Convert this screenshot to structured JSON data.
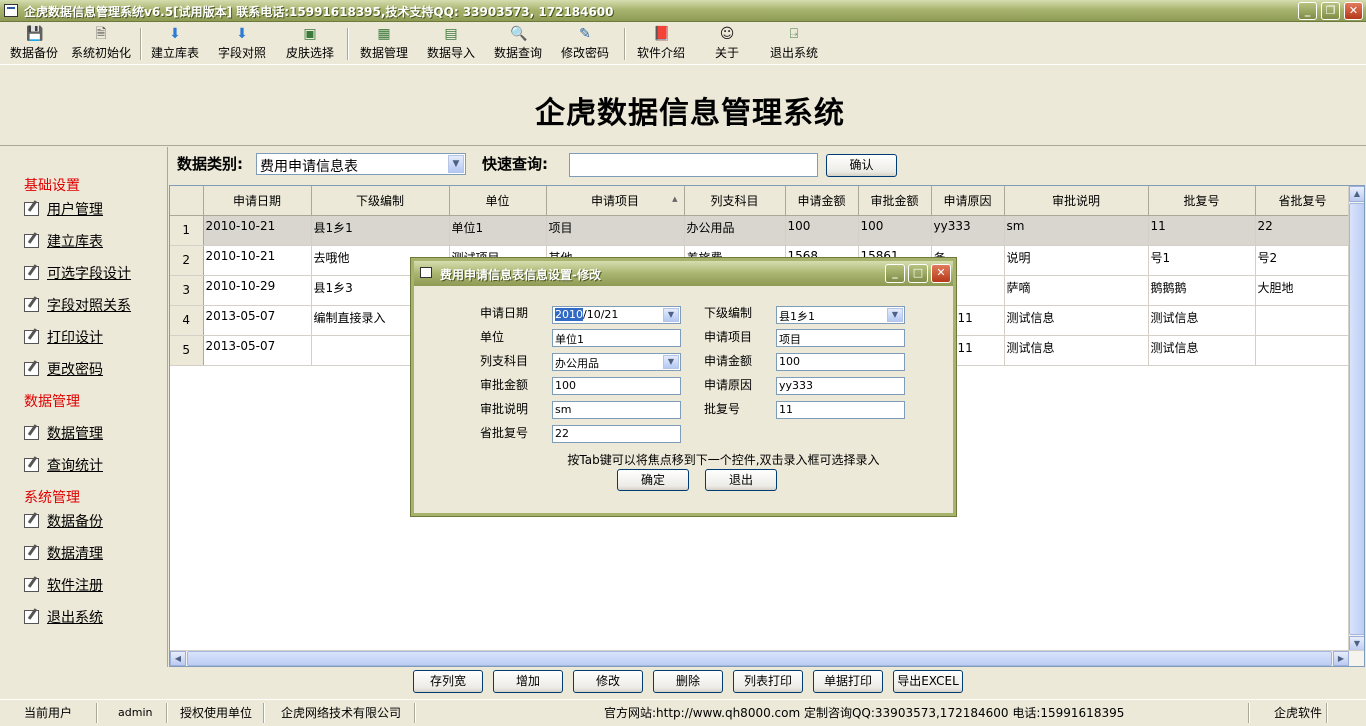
{
  "window": {
    "title": "企虎数据信息管理系统v6.5[试用版本]   联系电话:15991618395,技术支持QQ: 33903573, 172184600"
  },
  "toolbar": [
    {
      "label": "数据备份",
      "icon": "floppy-icon"
    },
    {
      "label": "系统初始化",
      "icon": "document-icon"
    },
    {
      "label": "建立库表",
      "icon": "arrow-down-icon"
    },
    {
      "label": "字段对照",
      "icon": "arrow-down-icon"
    },
    {
      "label": "皮肤选择",
      "icon": "image-icon"
    },
    {
      "label": "数据管理",
      "icon": "grid-icon"
    },
    {
      "label": "数据导入",
      "icon": "import-icon"
    },
    {
      "label": "数据查询",
      "icon": "magnifier-icon"
    },
    {
      "label": "修改密码",
      "icon": "pen-icon"
    },
    {
      "label": "软件介绍",
      "icon": "book-icon"
    },
    {
      "label": "关于",
      "icon": "person-icon"
    },
    {
      "label": "退出系统",
      "icon": "exit-door-icon"
    }
  ],
  "banner": {
    "heading": "企虎数据信息管理系统"
  },
  "sidebar": {
    "sections": [
      {
        "title": "基础设置",
        "items": [
          "用户管理",
          "建立库表",
          "可选字段设计",
          "字段对照关系",
          "打印设计",
          "更改密码"
        ]
      },
      {
        "title": "数据管理",
        "items": [
          "数据管理",
          "查询统计"
        ]
      },
      {
        "title": "系统管理",
        "items": [
          "数据备份",
          "数据清理",
          "软件注册",
          "退出系统"
        ]
      }
    ]
  },
  "filter": {
    "category_label": "数据类别:",
    "category_value": "费用申请信息表",
    "search_label": "快速查询:",
    "search_value": "",
    "confirm_label": "确认"
  },
  "grid": {
    "columns": [
      "申请日期",
      "下级编制",
      "单位",
      "申请项目",
      "列支科目",
      "申请金额",
      "审批金额",
      "申请原因",
      "审批说明",
      "批复号",
      "省批复号"
    ],
    "rows": [
      {
        "num": "1",
        "cells": [
          "2010-10-21",
          "县1乡1",
          "单位1",
          "项目",
          "办公用品",
          "100",
          "100",
          "yy333",
          "sm",
          "11",
          "22"
        ]
      },
      {
        "num": "2",
        "cells": [
          "2010-10-21",
          "去哦他",
          "测试项目",
          "其他",
          "差旅费",
          "1568",
          "15861",
          "务",
          "说明",
          "号1",
          "号2"
        ]
      },
      {
        "num": "3",
        "cells": [
          "2010-10-29",
          "县1乡3",
          "",
          "",
          "",
          "",
          "",
          "",
          "萨嘀",
          "鹅鹅鹅",
          "大胆地"
        ]
      },
      {
        "num": "4",
        "cells": [
          "2013-05-07",
          "编制直接录入",
          "",
          "",
          "",
          "",
          "",
          "信息11",
          "测试信息",
          "测试信息",
          ""
        ]
      },
      {
        "num": "5",
        "cells": [
          "2013-05-07",
          "",
          "",
          "",
          "",
          "",
          "",
          "信息11",
          "测试信息",
          "测试信息",
          ""
        ]
      }
    ]
  },
  "actions": [
    "存列宽",
    "增加",
    "修改",
    "删除",
    "列表打印",
    "单据打印",
    "导出EXCEL"
  ],
  "statusbar": {
    "user_label": "当前用户",
    "user_value": "admin",
    "org_label": "授权使用单位",
    "org_value": "企虎网络技术有限公司",
    "contact": "官方网站:http://www.qh8000.com 定制咨询QQ:33903573,172184600 电话:15991618395",
    "brand": "企虎软件"
  },
  "dialog": {
    "title": "费用申请信息表信息设置-修改",
    "fields": {
      "date_label": "申请日期",
      "date_value_sel": "2010",
      "date_value_rest": "/10/21",
      "sub_label": "下级编制",
      "sub_value": "县1乡1",
      "unit_label": "单位",
      "unit_value": "单位1",
      "project_label": "申请项目",
      "project_value": "项目",
      "subject_label": "列支科目",
      "subject_value": "办公用品",
      "amount_label": "申请金额",
      "amount_value": "100",
      "approved_label": "审批金额",
      "approved_value": "100",
      "reason_label": "申请原因",
      "reason_value": "yy333",
      "note_label": "审批说明",
      "note_value": "sm",
      "reply_label": "批复号",
      "reply_value": "11",
      "province_label": "省批复号",
      "province_value": "22"
    },
    "hint": "按Tab键可以将焦点移到下一个控件,双击录入框可选择录入",
    "ok_label": "确定",
    "exit_label": "退出"
  }
}
